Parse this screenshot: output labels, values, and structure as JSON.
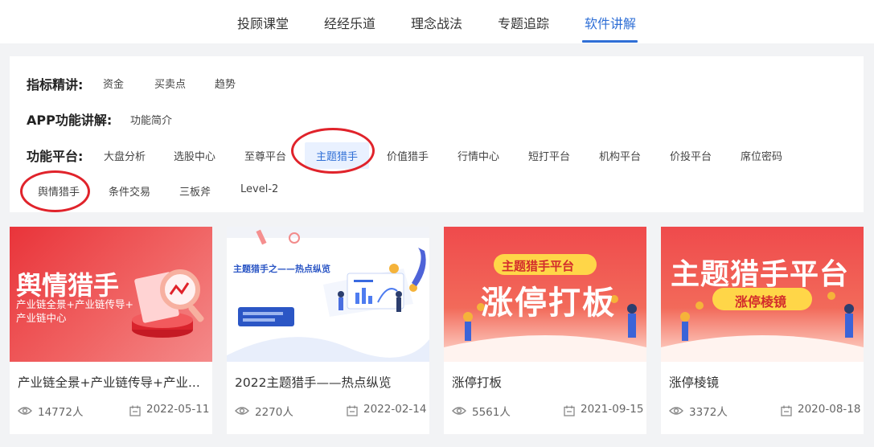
{
  "nav": {
    "tabs": [
      "投顾课堂",
      "经经乐道",
      "理念战法",
      "专题追踪",
      "软件讲解"
    ],
    "active_tab": "软件讲解"
  },
  "filters": {
    "indicators": {
      "label": "指标精讲:",
      "items": [
        "资金",
        "买卖点",
        "趋势"
      ]
    },
    "app": {
      "label": "APP功能讲解:",
      "items": [
        "功能简介"
      ]
    },
    "platform": {
      "label": "功能平台:",
      "items": [
        "大盘分析",
        "选股中心",
        "至尊平台",
        "主题猎手",
        "价值猎手",
        "行情中心",
        "短打平台",
        "机构平台",
        "价投平台",
        "席位密码",
        "舆情猎手",
        "条件交易",
        "三板斧",
        "Level-2"
      ],
      "selected": "主题猎手"
    }
  },
  "colors": {
    "accent": "#2f6fd6",
    "highlight_ring": "#e0232b",
    "banner_red": "#ef4a4c"
  },
  "cards": [
    {
      "title": "产业链全景+产业链传导+产业...",
      "views": "14772人",
      "date": "2022-05-11",
      "thumb": {
        "heading": "舆情猎手",
        "sub1": "产业链全景+产业链传导+",
        "sub2": "产业链中心"
      }
    },
    {
      "title": "2022主题猎手——热点纵览",
      "views": "2270人",
      "date": "2022-02-14",
      "thumb": {
        "heading": "主题猎手之——热点纵览"
      }
    },
    {
      "title": "涨停打板",
      "views": "5561人",
      "date": "2021-09-15",
      "thumb": {
        "pill": "主题猎手平台",
        "heading": "涨停打板"
      }
    },
    {
      "title": "涨停棱镜",
      "views": "3372人",
      "date": "2020-08-18",
      "thumb": {
        "heading": "主题猎手平台",
        "pill": "涨停棱镜"
      }
    }
  ],
  "icons": {
    "views": "eye-icon",
    "date": "calendar-icon"
  }
}
